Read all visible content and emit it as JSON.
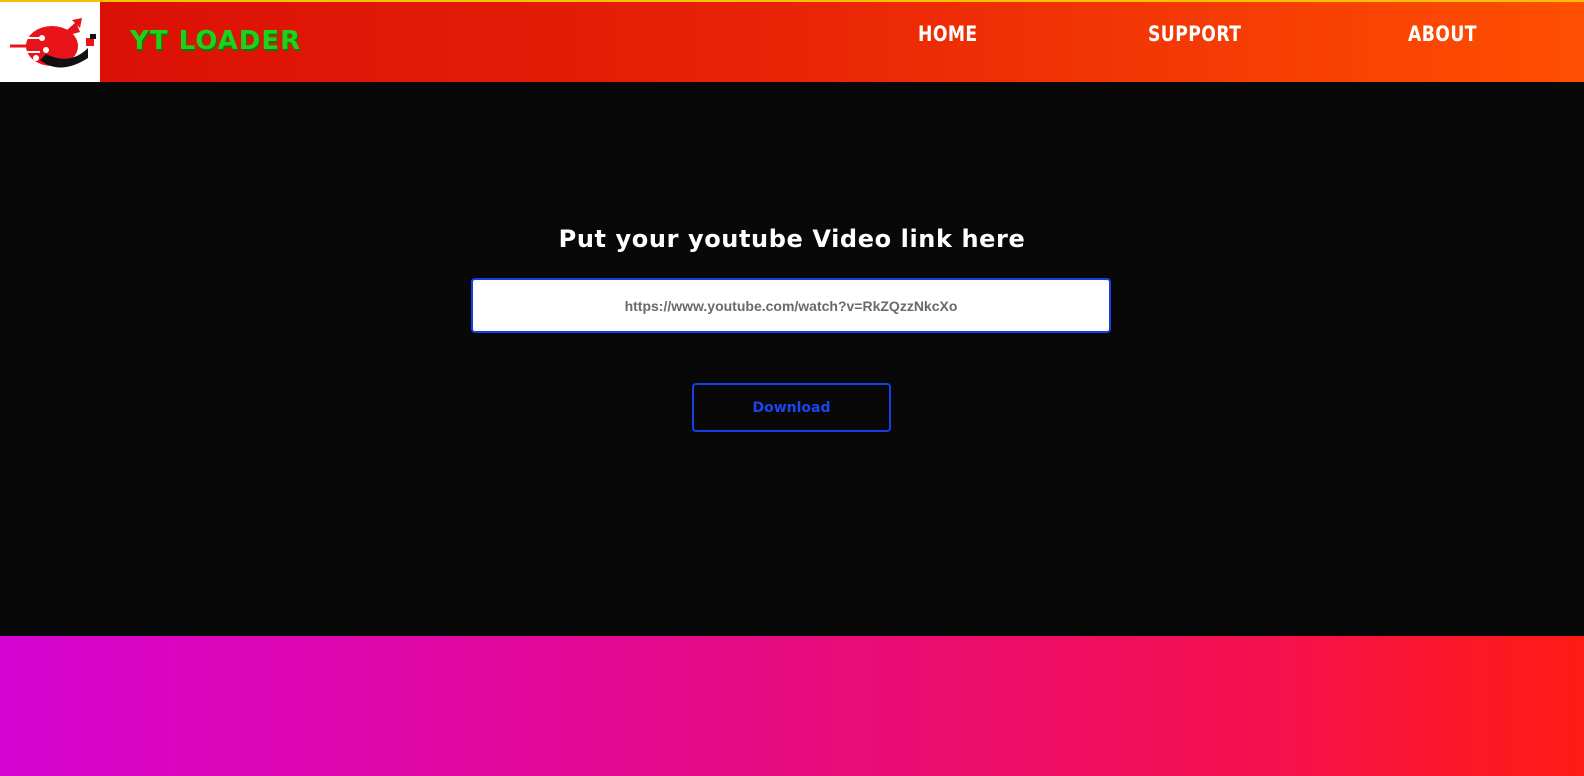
{
  "header": {
    "brand": "YT LOADER",
    "nav": [
      {
        "label": "HOME"
      },
      {
        "label": "SUPPORT"
      },
      {
        "label": "ABOUT"
      }
    ]
  },
  "main": {
    "headline": "Put your youtube Video link here",
    "url_value": "https://www.youtube.com/watch?v=RkZQzzNkcXo",
    "download_label": "Download"
  },
  "colors": {
    "header_start": "#d90e06",
    "header_end": "#ff4f02",
    "brand": "#1fd11a",
    "accent_blue": "#1540e6",
    "background": "#080808",
    "footer_start": "#d604d2",
    "footer_end": "#ff1b12"
  },
  "icons": {
    "logo": "rocket-logo-icon"
  }
}
